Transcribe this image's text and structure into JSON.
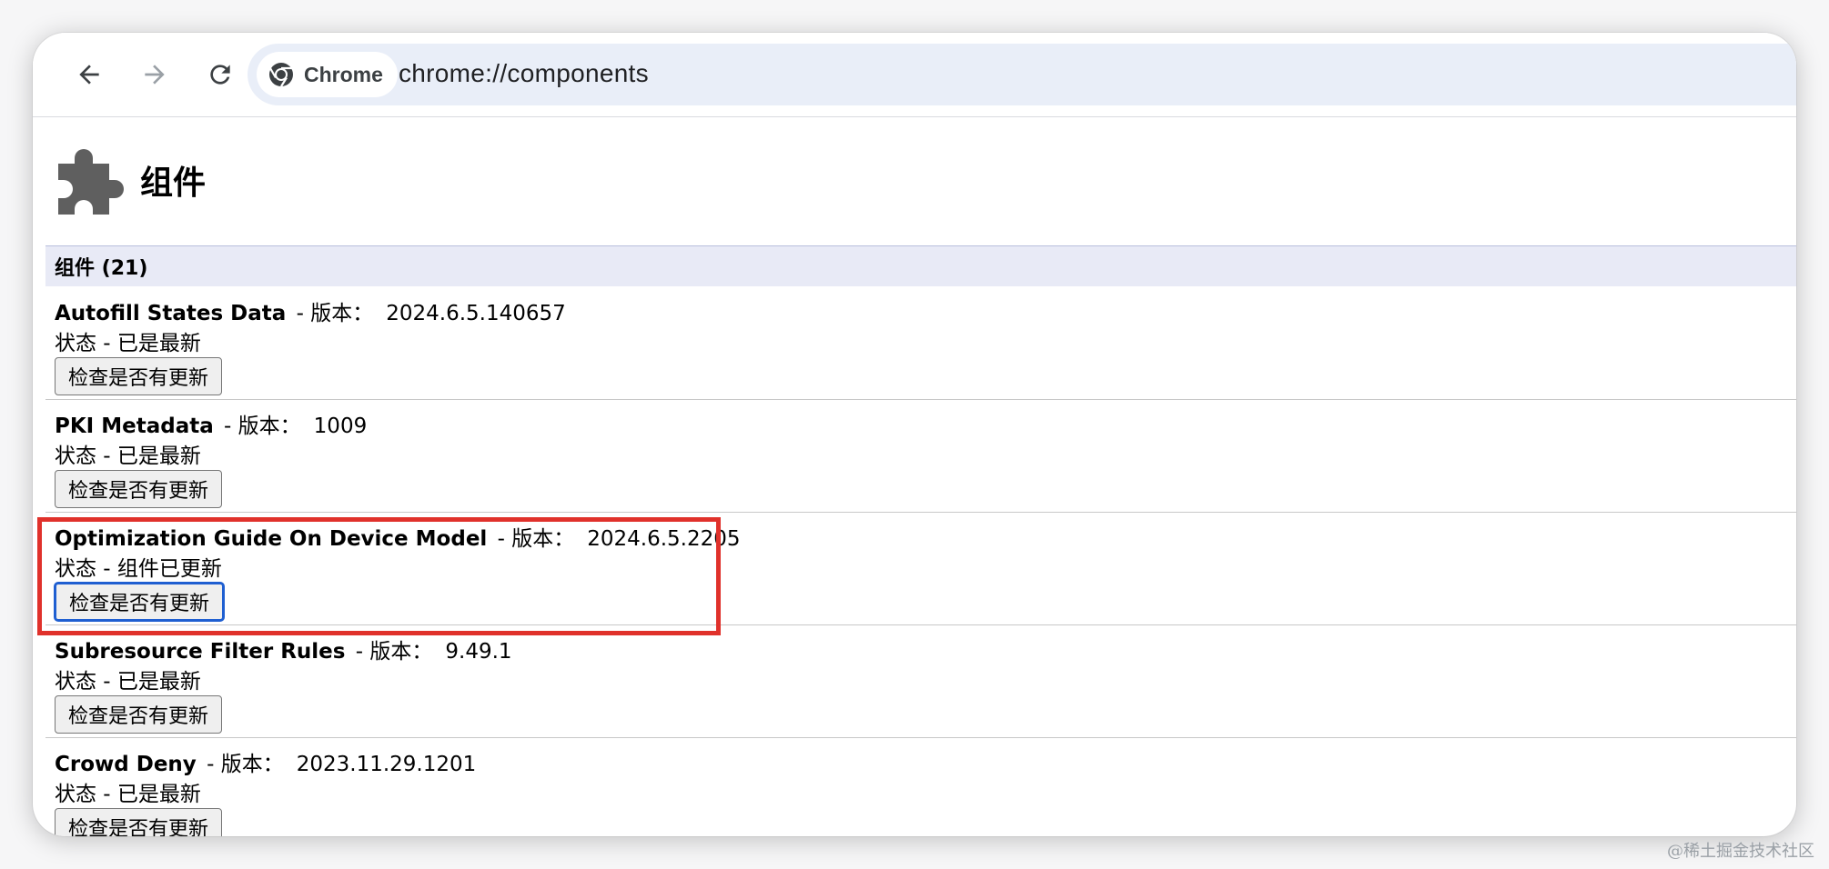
{
  "browser": {
    "chip_label": "Chrome",
    "url": "chrome://components"
  },
  "page": {
    "title": "组件",
    "section_header": "组件 (21)"
  },
  "labels": {
    "version_sep": " - 版本：",
    "status_prefix": "状态 - ",
    "check_button": "检查是否有更新"
  },
  "components": [
    {
      "name": "Autofill States Data",
      "version": "2024.6.5.140657",
      "status": "已是最新"
    },
    {
      "name": "PKI Metadata",
      "version": "1009",
      "status": "已是最新"
    },
    {
      "name": "Optimization Guide On Device Model",
      "version": "2024.6.5.2205",
      "status": "组件已更新"
    },
    {
      "name": "Subresource Filter Rules",
      "version": "9.49.1",
      "status": "已是最新"
    },
    {
      "name": "Crowd Deny",
      "version": "2023.11.29.1201",
      "status": "已是最新"
    }
  ],
  "colors": {
    "highlight": "#e0312b",
    "focus_ring": "#1f5fd1",
    "section_bg": "#e8eaf6",
    "omnibox_bg": "#e9eef8"
  },
  "icons": {
    "back": "arrow-left-icon",
    "forward": "arrow-right-icon",
    "reload": "reload-icon",
    "chrome": "chrome-logo-icon",
    "page": "puzzle-piece-icon"
  },
  "watermark": "@稀土掘金技术社区"
}
